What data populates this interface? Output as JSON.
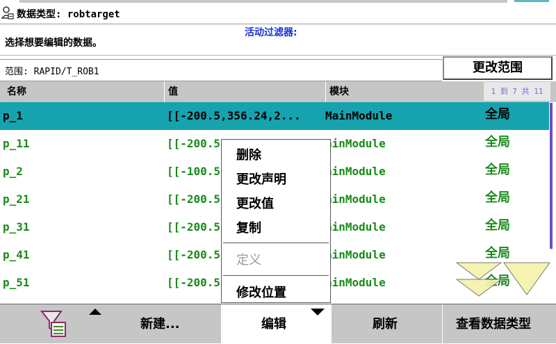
{
  "header": {
    "title": "数据类型: robtarget",
    "filter_label": "活动过滤器:",
    "instruction": "选择想要编辑的数据。"
  },
  "scope": {
    "label": "范围: RAPID/T_ROB1",
    "button_label": "更改范围"
  },
  "table": {
    "columns": [
      "名称",
      "值",
      "模块"
    ],
    "page_indicator": "1 到 7 共 11",
    "rows": [
      {
        "name": "p_1",
        "value": "[[-200.5,356.24,2...",
        "module": "MainModule",
        "scope": "全局",
        "selected": true
      },
      {
        "name": "p_11",
        "value": "[[-200.5",
        "module": "ainModule",
        "scope": "全局"
      },
      {
        "name": "p_2",
        "value": "[[-100.5",
        "module": "ainModule",
        "scope": "全局"
      },
      {
        "name": "p_21",
        "value": "[[-200.5",
        "module": "ainModule",
        "scope": "全局"
      },
      {
        "name": "p_31",
        "value": "[[-200.5",
        "module": "ainModule",
        "scope": "全局"
      },
      {
        "name": "p_41",
        "value": "[[-200.5",
        "module": "ainModule",
        "scope": "全局"
      },
      {
        "name": "p_51",
        "value": "[[-200.5",
        "module": "ainModule",
        "scope": "全局"
      }
    ]
  },
  "context_menu": {
    "items": [
      {
        "label": "删除",
        "enabled": true
      },
      {
        "label": "更改声明",
        "enabled": true
      },
      {
        "label": "更改值",
        "enabled": true
      },
      {
        "label": "复制",
        "enabled": true
      },
      {
        "label": "定义",
        "enabled": false
      },
      {
        "label": "修改位置",
        "enabled": true
      }
    ]
  },
  "toolbar": {
    "new_label": "新建...",
    "edit_label": "编辑",
    "refresh_label": "刷新",
    "view_type_label": "查看数据类型"
  },
  "colors": {
    "selected_row": "#17a3ae",
    "row_text": "#1a8a1a",
    "filter_text": "#1a33d6",
    "toolbar": "#c6c6c6",
    "arrow": "#f4f2a8"
  }
}
